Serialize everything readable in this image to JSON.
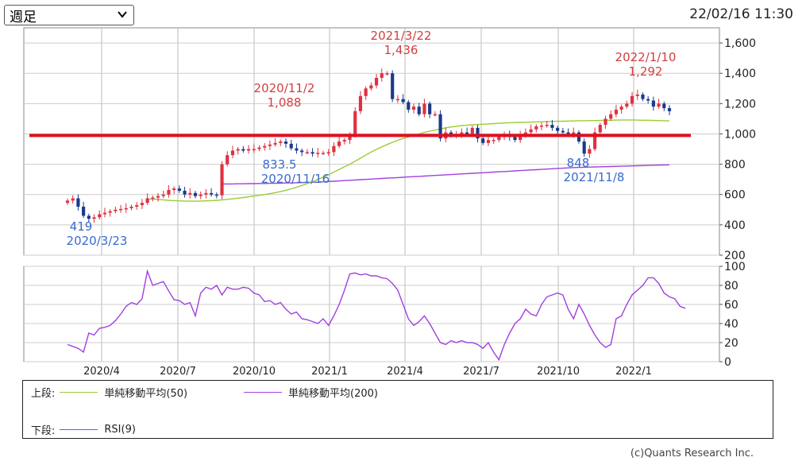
{
  "period_select": {
    "value": "週足"
  },
  "timestamp": "22/02/16 11:30",
  "legend": {
    "upper_label": "上段:",
    "ma50_label": "単純移動平均(50)",
    "ma200_label": "単純移動平均(200)",
    "lower_label": "下段:",
    "rsi_label": "RSI(9)",
    "ma50_color": "#9acd32",
    "ma200_color": "#a040e0",
    "rsi_color": "#a040e0"
  },
  "copyright": "(c)Quants Research Inc.",
  "colors": {
    "up_candle": "#e03040",
    "down_candle": "#1a3a8a",
    "annotation_high": "#d04040",
    "annotation_low": "#3a6ad0",
    "reference_line": "#e01020"
  },
  "chart_data": {
    "type": "candlestick",
    "x_tick_labels": [
      "2020/4",
      "2020/7",
      "2020/10",
      "2021/1",
      "2021/4",
      "2021/7",
      "2021/10",
      "2022/1"
    ],
    "price_axis": {
      "ylim": [
        200,
        1700
      ],
      "ticks": [
        "1,600",
        "1,400",
        "1,200",
        "1,000",
        "800",
        "600",
        "400",
        "200"
      ],
      "tick_values": [
        1600,
        1400,
        1200,
        1000,
        800,
        600,
        400,
        200
      ]
    },
    "rsi_axis": {
      "ylim": [
        0,
        100
      ],
      "ticks": [
        "100",
        "80",
        "60",
        "40",
        "20",
        "0"
      ],
      "tick_values": [
        100,
        80,
        60,
        40,
        20,
        0
      ]
    },
    "reference_line_value": 990,
    "annotations": [
      {
        "date": "2021/3/22",
        "value": "1,436",
        "type": "high"
      },
      {
        "date": "2020/11/2",
        "value": "1,088",
        "type": "high"
      },
      {
        "date": "2022/1/10",
        "value": "1,292",
        "type": "high"
      },
      {
        "date": "2020/3/23",
        "value": "419",
        "type": "low"
      },
      {
        "date": "2020/11/16",
        "value": "833.5",
        "type": "low"
      },
      {
        "date": "2021/11/8",
        "value": "848",
        "type": "low"
      }
    ],
    "close": [
      560,
      575,
      520,
      460,
      440,
      450,
      470,
      480,
      490,
      500,
      505,
      510,
      520,
      530,
      545,
      575,
      580,
      590,
      600,
      630,
      640,
      625,
      600,
      610,
      590,
      600,
      610,
      600,
      595,
      800,
      860,
      890,
      900,
      890,
      900,
      900,
      910,
      920,
      930,
      940,
      950,
      935,
      905,
      890,
      880,
      880,
      870,
      875,
      875,
      880,
      920,
      950,
      960,
      990,
      1150,
      1250,
      1300,
      1320,
      1370,
      1400,
      1400,
      1230,
      1230,
      1210,
      1160,
      1180,
      1130,
      1200,
      1130,
      1130,
      970,
      1010,
      990,
      1000,
      1010,
      1000,
      1040,
      970,
      940,
      960,
      960,
      980,
      990,
      980,
      960,
      1000,
      1010,
      1030,
      1050,
      1055,
      1060,
      1040,
      1020,
      1010,
      1000,
      1010,
      950,
      870,
      900,
      1010,
      1060,
      1100,
      1130,
      1160,
      1180,
      1200,
      1250,
      1260,
      1230,
      1220,
      1180,
      1200,
      1170,
      1150
    ],
    "ma50": [
      570,
      570,
      568,
      565,
      562,
      560,
      558,
      557,
      556,
      556,
      557,
      558,
      560,
      562,
      565,
      568,
      572,
      576,
      580,
      585,
      590,
      595,
      600,
      606,
      612,
      620,
      628,
      638,
      648,
      660,
      672,
      685,
      700,
      715,
      730,
      748,
      766,
      784,
      800,
      820,
      840,
      860,
      880,
      898,
      915,
      930,
      945,
      958,
      970,
      980,
      990,
      1000,
      1010,
      1018,
      1026,
      1033,
      1040,
      1046,
      1050,
      1055,
      1058,
      1060,
      1062,
      1064,
      1066,
      1068,
      1070,
      1072,
      1074,
      1075,
      1076,
      1077,
      1078,
      1079,
      1080,
      1081,
      1082,
      1083,
      1084,
      1085,
      1086,
      1087,
      1087,
      1088,
      1088,
      1089,
      1090,
      1090,
      1091,
      1092,
      1092,
      1092,
      1091,
      1090,
      1090,
      1089,
      1088,
      1087,
      1086
    ],
    "ma200": [
      670,
      670,
      670,
      671,
      671,
      672,
      672,
      673,
      673,
      674,
      674,
      675,
      676,
      677,
      678,
      679,
      680,
      681,
      682,
      684,
      686,
      688,
      690,
      692,
      694,
      696,
      698,
      700,
      702,
      704,
      706,
      708,
      710,
      712,
      714,
      716,
      718,
      720,
      722,
      724,
      726,
      728,
      730,
      732,
      734,
      736,
      738,
      740,
      742,
      744,
      746,
      748,
      750,
      752,
      754,
      756,
      758,
      760,
      762,
      764,
      766,
      768,
      770,
      772,
      774,
      776,
      778,
      779,
      780,
      781,
      782,
      783,
      784,
      785,
      786,
      787,
      788,
      789,
      790,
      791,
      792,
      793,
      794,
      795,
      796
    ],
    "rsi": [
      18,
      16,
      14,
      10,
      30,
      28,
      35,
      36,
      38,
      43,
      50,
      58,
      62,
      60,
      66,
      95,
      80,
      82,
      84,
      74,
      65,
      64,
      60,
      62,
      48,
      72,
      78,
      76,
      80,
      70,
      78,
      76,
      76,
      78,
      77,
      72,
      70,
      63,
      64,
      60,
      62,
      55,
      50,
      52,
      45,
      44,
      42,
      40,
      45,
      38,
      48,
      60,
      75,
      92,
      93,
      91,
      92,
      90,
      90,
      88,
      87,
      82,
      75,
      60,
      45,
      38,
      42,
      48,
      40,
      30,
      20,
      18,
      22,
      20,
      22,
      20,
      20,
      18,
      14,
      20,
      10,
      2,
      18,
      30,
      40,
      45,
      55,
      50,
      48,
      60,
      68,
      70,
      72,
      70,
      55,
      45,
      60,
      50,
      38,
      28,
      20,
      15,
      18,
      45,
      48,
      60,
      70,
      75,
      80,
      88,
      88,
      82,
      72,
      68,
      66,
      58,
      56
    ]
  }
}
